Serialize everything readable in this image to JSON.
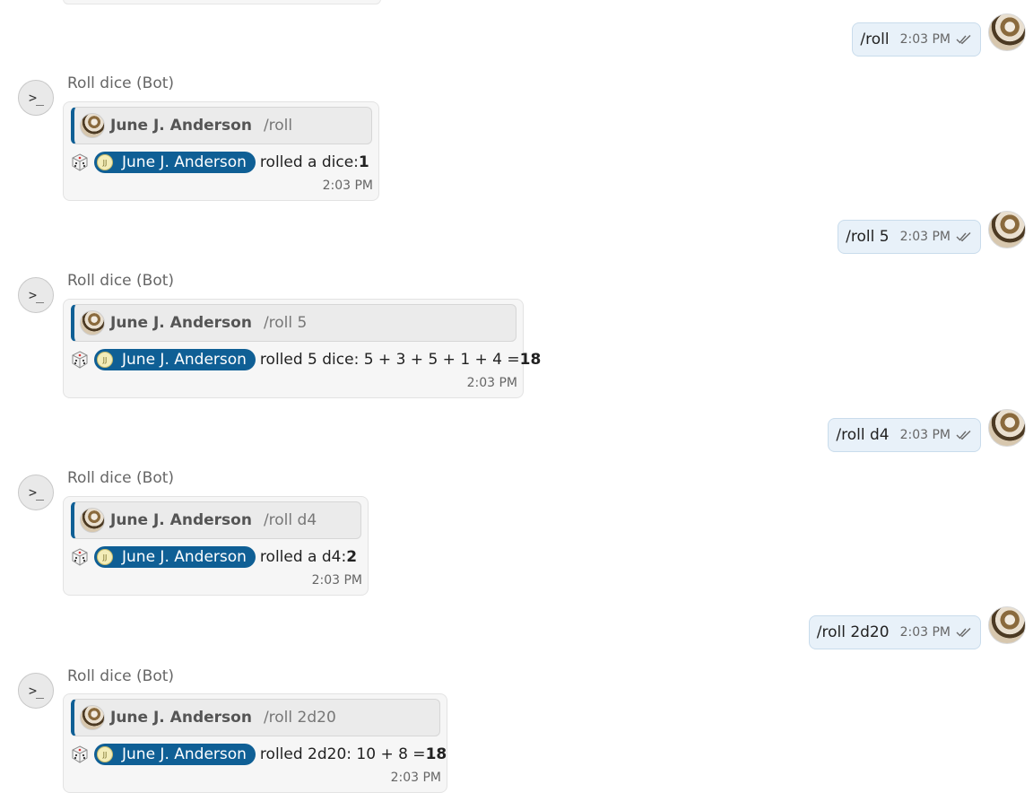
{
  "messages": [
    {
      "outgoing": {
        "text": "/roll",
        "time": "2:03 PM"
      },
      "bot": {
        "name": "Roll dice (Bot)",
        "quote_author": "June J. Anderson",
        "quote_command": "/roll",
        "mention": "June J. Anderson",
        "mention_initials": "JJ",
        "result_prefix": "rolled a dice: ",
        "result_bold": "1",
        "time": "2:03 PM"
      }
    },
    {
      "outgoing": {
        "text": "/roll 5",
        "time": "2:03 PM"
      },
      "bot": {
        "name": "Roll dice (Bot)",
        "quote_author": "June J. Anderson",
        "quote_command": "/roll 5",
        "mention": "June J. Anderson",
        "mention_initials": "JJ",
        "result_prefix": "rolled 5 dice: 5 + 3 + 5 + 1 + 4 = ",
        "result_bold": "18",
        "time": "2:03 PM"
      }
    },
    {
      "outgoing": {
        "text": "/roll d4",
        "time": "2:03 PM"
      },
      "bot": {
        "name": "Roll dice (Bot)",
        "quote_author": "June J. Anderson",
        "quote_command": "/roll d4",
        "mention": "June J. Anderson",
        "mention_initials": "JJ",
        "result_prefix": "rolled a d4: ",
        "result_bold": "2",
        "time": "2:03 PM"
      }
    },
    {
      "outgoing": {
        "text": "/roll 2d20",
        "time": "2:03 PM"
      },
      "bot": {
        "name": "Roll dice (Bot)",
        "quote_author": "June J. Anderson",
        "quote_command": "/roll 2d20",
        "mention": "June J. Anderson",
        "mention_initials": "JJ",
        "result_prefix": "rolled 2d20: 10 + 8 = ",
        "result_bold": "18",
        "time": "2:03 PM"
      }
    }
  ],
  "bot_avatar_glyph": ">_",
  "colors": {
    "mention_bg": "#0f5f95",
    "outgoing_bg": "#e8f1f9",
    "bot_bubble_bg": "#f6f6f6"
  },
  "icons": {
    "delivered": "double-check-icon",
    "dice": "dice-icon",
    "bot_avatar": "terminal-icon"
  }
}
